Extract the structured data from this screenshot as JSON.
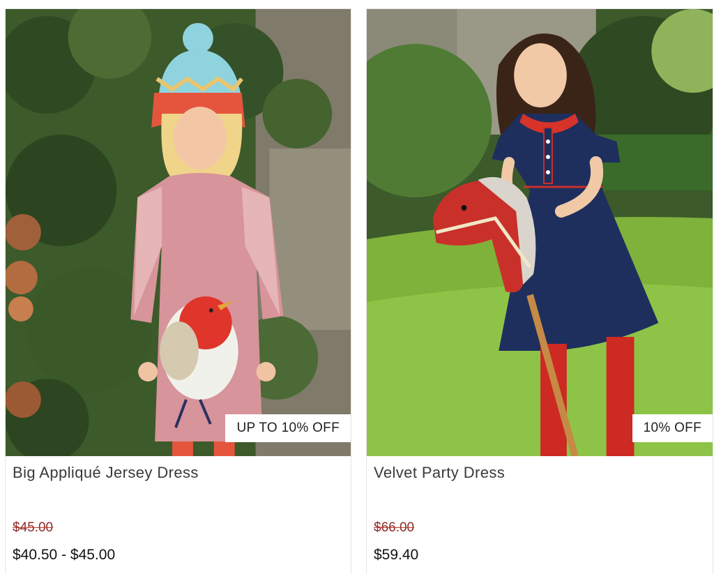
{
  "products": [
    {
      "title": "Big Appliqué Jersey Dress",
      "badge": "UP TO 10% OFF",
      "original_price": "$45.00",
      "sale_price": "$40.50 - $45.00",
      "image_icon": "product-photo-girl-robin-dress"
    },
    {
      "title": "Velvet Party Dress",
      "badge": "10% OFF",
      "original_price": "$66.00",
      "sale_price": "$59.40",
      "image_icon": "product-photo-girl-velvet-dress"
    }
  ],
  "colors": {
    "strike_red": "#c0392b",
    "badge_bg": "#ffffff"
  }
}
